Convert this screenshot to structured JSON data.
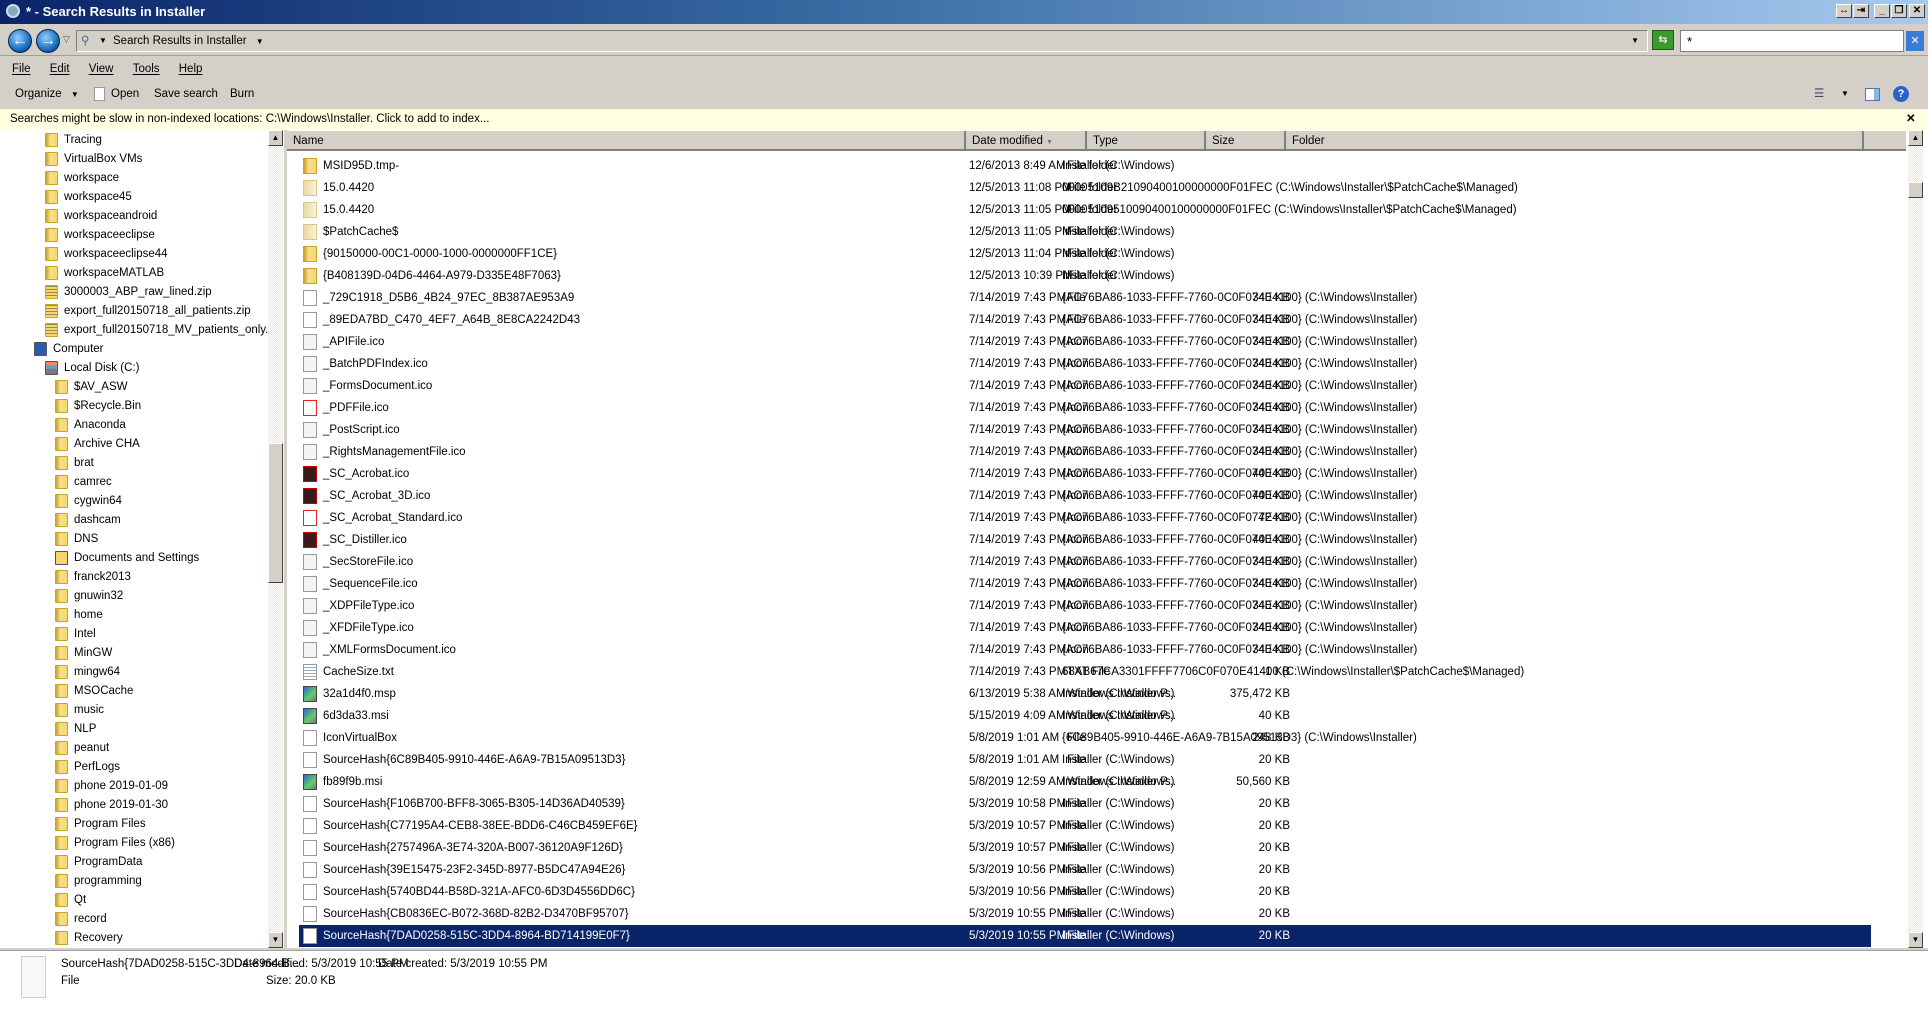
{
  "window": {
    "title": "* - Search Results in Installer"
  },
  "address": {
    "path": "Search Results in Installer",
    "search_value": "*"
  },
  "menu": [
    "File",
    "Edit",
    "View",
    "Tools",
    "Help"
  ],
  "toolbar": {
    "organize": "Organize",
    "open": "Open",
    "save_search": "Save search",
    "burn": "Burn"
  },
  "infobar": {
    "text": "Searches might be slow in non-indexed locations: C:\\Windows\\Installer. Click to add to index..."
  },
  "nav": [
    {
      "label": "Tracing",
      "level": 1,
      "icon": "folder"
    },
    {
      "label": "VirtualBox VMs",
      "level": 1,
      "icon": "folder"
    },
    {
      "label": "workspace",
      "level": 1,
      "icon": "folder"
    },
    {
      "label": "workspace45",
      "level": 1,
      "icon": "folder"
    },
    {
      "label": "workspaceandroid",
      "level": 1,
      "icon": "folder"
    },
    {
      "label": "workspaceeclipse",
      "level": 1,
      "icon": "folder"
    },
    {
      "label": "workspaceeclipse44",
      "level": 1,
      "icon": "folder"
    },
    {
      "label": "workspaceMATLAB",
      "level": 1,
      "icon": "folder"
    },
    {
      "label": "3000003_ABP_raw_lined.zip",
      "level": 1,
      "icon": "zip"
    },
    {
      "label": "export_full20150718_all_patients.zip",
      "level": 1,
      "icon": "zip"
    },
    {
      "label": "export_full20150718_MV_patients_only.zip",
      "level": 1,
      "icon": "zip"
    },
    {
      "label": "Computer",
      "level": 0,
      "icon": "computer"
    },
    {
      "label": "Local Disk (C:)",
      "level": 1,
      "icon": "drive"
    },
    {
      "label": "$AV_ASW",
      "level": 2,
      "icon": "folder"
    },
    {
      "label": "$Recycle.Bin",
      "level": 2,
      "icon": "folder"
    },
    {
      "label": "Anaconda",
      "level": 2,
      "icon": "folder"
    },
    {
      "label": "Archive CHA",
      "level": 2,
      "icon": "folder"
    },
    {
      "label": "brat",
      "level": 2,
      "icon": "folder"
    },
    {
      "label": "camrec",
      "level": 2,
      "icon": "folder"
    },
    {
      "label": "cygwin64",
      "level": 2,
      "icon": "folder"
    },
    {
      "label": "dashcam",
      "level": 2,
      "icon": "folder"
    },
    {
      "label": "DNS",
      "level": 2,
      "icon": "folder"
    },
    {
      "label": "Documents and Settings",
      "level": 2,
      "icon": "shortcut"
    },
    {
      "label": "franck2013",
      "level": 2,
      "icon": "folder"
    },
    {
      "label": "gnuwin32",
      "level": 2,
      "icon": "folder"
    },
    {
      "label": "home",
      "level": 2,
      "icon": "folder"
    },
    {
      "label": "Intel",
      "level": 2,
      "icon": "folder"
    },
    {
      "label": "MinGW",
      "level": 2,
      "icon": "folder"
    },
    {
      "label": "mingw64",
      "level": 2,
      "icon": "folder"
    },
    {
      "label": "MSOCache",
      "level": 2,
      "icon": "folder"
    },
    {
      "label": "music",
      "level": 2,
      "icon": "folder"
    },
    {
      "label": "NLP",
      "level": 2,
      "icon": "folder"
    },
    {
      "label": "peanut",
      "level": 2,
      "icon": "folder"
    },
    {
      "label": "PerfLogs",
      "level": 2,
      "icon": "folder"
    },
    {
      "label": "phone 2019-01-09",
      "level": 2,
      "icon": "folder"
    },
    {
      "label": "phone 2019-01-30",
      "level": 2,
      "icon": "folder"
    },
    {
      "label": "Program Files",
      "level": 2,
      "icon": "folder"
    },
    {
      "label": "Program Files (x86)",
      "level": 2,
      "icon": "folder"
    },
    {
      "label": "ProgramData",
      "level": 2,
      "icon": "folder"
    },
    {
      "label": "programming",
      "level": 2,
      "icon": "folder"
    },
    {
      "label": "Qt",
      "level": 2,
      "icon": "folder"
    },
    {
      "label": "record",
      "level": 2,
      "icon": "folder"
    },
    {
      "label": "Recovery",
      "level": 2,
      "icon": "folder"
    }
  ],
  "columns": {
    "name": "Name",
    "date": "Date modified",
    "type": "Type",
    "size": "Size",
    "folder": "Folder"
  },
  "files": [
    {
      "name": "MSID95D.tmp-",
      "date": "12/6/2013 8:49 AM",
      "type": "File folder",
      "size": "",
      "folder": "Installer (C:\\Windows)",
      "icon": "folder"
    },
    {
      "name": "15.0.4420",
      "date": "12/5/2013 11:08 PM",
      "type": "File folder",
      "size": "",
      "folder": "00005109B21090400100000000F01FEC (C:\\Windows\\Installer\\$PatchCache$\\Managed)",
      "icon": "folder-light"
    },
    {
      "name": "15.0.4420",
      "date": "12/5/2013 11:05 PM",
      "type": "File folder",
      "size": "",
      "folder": "00005109510090400100000000F01FEC (C:\\Windows\\Installer\\$PatchCache$\\Managed)",
      "icon": "folder-light"
    },
    {
      "name": "$PatchCache$",
      "date": "12/5/2013 11:05 PM",
      "type": "File folder",
      "size": "",
      "folder": "Installer (C:\\Windows)",
      "icon": "folder-light"
    },
    {
      "name": "{90150000-00C1-0000-1000-0000000FF1CE}",
      "date": "12/5/2013 11:04 PM",
      "type": "File folder",
      "size": "",
      "folder": "Installer (C:\\Windows)",
      "icon": "folder"
    },
    {
      "name": "{B408139D-04D6-4464-A979-D335E48F7063}",
      "date": "12/5/2013 10:39 PM",
      "type": "File folder",
      "size": "",
      "folder": "Installer (C:\\Windows)",
      "icon": "folder"
    },
    {
      "name": "_729C1918_D5B6_4B24_97EC_8B387AE953A9",
      "date": "7/14/2019 7:43 PM",
      "type": "File",
      "size": "340 KB",
      "folder": "{AC76BA86-1033-FFFF-7760-0C0F074E4100} (C:\\Windows\\Installer)",
      "icon": "file"
    },
    {
      "name": "_89EDA7BD_C470_4EF7_A64B_8E8CA2242D43",
      "date": "7/14/2019 7:43 PM",
      "type": "File",
      "size": "340 KB",
      "folder": "{AC76BA86-1033-FFFF-7760-0C0F074E4100} (C:\\Windows\\Installer)",
      "icon": "file"
    },
    {
      "name": "_APIFile.ico",
      "date": "7/14/2019 7:43 PM",
      "type": "Icon",
      "size": "340 KB",
      "folder": "{AC76BA86-1033-FFFF-7760-0C0F074E4100} (C:\\Windows\\Installer)",
      "icon": "ico"
    },
    {
      "name": "_BatchPDFIndex.ico",
      "date": "7/14/2019 7:43 PM",
      "type": "Icon",
      "size": "340 KB",
      "folder": "{AC76BA86-1033-FFFF-7760-0C0F074E4100} (C:\\Windows\\Installer)",
      "icon": "ico"
    },
    {
      "name": "_FormsDocument.ico",
      "date": "7/14/2019 7:43 PM",
      "type": "Icon",
      "size": "340 KB",
      "folder": "{AC76BA86-1033-FFFF-7760-0C0F074E4100} (C:\\Windows\\Installer)",
      "icon": "ico"
    },
    {
      "name": "_PDFFile.ico",
      "date": "7/14/2019 7:43 PM",
      "type": "Icon",
      "size": "340 KB",
      "folder": "{AC76BA86-1033-FFFF-7760-0C0F074E4100} (C:\\Windows\\Installer)",
      "icon": "pdf"
    },
    {
      "name": "_PostScript.ico",
      "date": "7/14/2019 7:43 PM",
      "type": "Icon",
      "size": "340 KB",
      "folder": "{AC76BA86-1033-FFFF-7760-0C0F074E4100} (C:\\Windows\\Installer)",
      "icon": "ico"
    },
    {
      "name": "_RightsManagementFile.ico",
      "date": "7/14/2019 7:43 PM",
      "type": "Icon",
      "size": "340 KB",
      "folder": "{AC76BA86-1033-FFFF-7760-0C0F074E4100} (C:\\Windows\\Installer)",
      "icon": "ico"
    },
    {
      "name": "_SC_Acrobat.ico",
      "date": "7/14/2019 7:43 PM",
      "type": "Icon",
      "size": "400 KB",
      "folder": "{AC76BA86-1033-FFFF-7760-0C0F074E4100} (C:\\Windows\\Installer)",
      "icon": "acrobat"
    },
    {
      "name": "_SC_Acrobat_3D.ico",
      "date": "7/14/2019 7:43 PM",
      "type": "Icon",
      "size": "400 KB",
      "folder": "{AC76BA86-1033-FFFF-7760-0C0F074E4100} (C:\\Windows\\Installer)",
      "icon": "acrobat"
    },
    {
      "name": "_SC_Acrobat_Standard.ico",
      "date": "7/14/2019 7:43 PM",
      "type": "Icon",
      "size": "72 KB",
      "folder": "{AC76BA86-1033-FFFF-7760-0C0F074E4100} (C:\\Windows\\Installer)",
      "icon": "pdf"
    },
    {
      "name": "_SC_Distiller.ico",
      "date": "7/14/2019 7:43 PM",
      "type": "Icon",
      "size": "400 KB",
      "folder": "{AC76BA86-1033-FFFF-7760-0C0F074E4100} (C:\\Windows\\Installer)",
      "icon": "acrobat"
    },
    {
      "name": "_SecStoreFile.ico",
      "date": "7/14/2019 7:43 PM",
      "type": "Icon",
      "size": "340 KB",
      "folder": "{AC76BA86-1033-FFFF-7760-0C0F074E4100} (C:\\Windows\\Installer)",
      "icon": "ico"
    },
    {
      "name": "_SequenceFile.ico",
      "date": "7/14/2019 7:43 PM",
      "type": "Icon",
      "size": "340 KB",
      "folder": "{AC76BA86-1033-FFFF-7760-0C0F074E4100} (C:\\Windows\\Installer)",
      "icon": "ico"
    },
    {
      "name": "_XDPFileType.ico",
      "date": "7/14/2019 7:43 PM",
      "type": "Icon",
      "size": "340 KB",
      "folder": "{AC76BA86-1033-FFFF-7760-0C0F074E4100} (C:\\Windows\\Installer)",
      "icon": "ico"
    },
    {
      "name": "_XFDFileType.ico",
      "date": "7/14/2019 7:43 PM",
      "type": "Icon",
      "size": "340 KB",
      "folder": "{AC76BA86-1033-FFFF-7760-0C0F074E4100} (C:\\Windows\\Installer)",
      "icon": "ico"
    },
    {
      "name": "_XMLFormsDocument.ico",
      "date": "7/14/2019 7:43 PM",
      "type": "Icon",
      "size": "340 KB",
      "folder": "{AC76BA86-1033-FFFF-7760-0C0F074E4100} (C:\\Windows\\Installer)",
      "icon": "ico"
    },
    {
      "name": "CacheSize.txt",
      "date": "7/14/2019 7:43 PM",
      "type": "TXT File",
      "size": "1 KB",
      "folder": "68AB67CA3301FFFF7706C0F070E41400 (C:\\Windows\\Installer\\$PatchCache$\\Managed)",
      "icon": "txt"
    },
    {
      "name": "32a1d4f0.msp",
      "date": "6/13/2019 5:38 AM",
      "type": "Windows Installer P...",
      "size": "375,472 KB",
      "folder": "Installer (C:\\Windows)",
      "icon": "msi"
    },
    {
      "name": "6d3da33.msi",
      "date": "5/15/2019 4:09 AM",
      "type": "Windows Installer P...",
      "size": "40 KB",
      "folder": "Installer (C:\\Windows)",
      "icon": "msi"
    },
    {
      "name": "IconVirtualBox",
      "date": "5/8/2019 1:01 AM",
      "type": "File",
      "size": "248 KB",
      "folder": "{6C89B405-9910-446E-A6A9-7B15A09513D3} (C:\\Windows\\Installer)",
      "icon": "file"
    },
    {
      "name": "SourceHash{6C89B405-9910-446E-A6A9-7B15A09513D3}",
      "date": "5/8/2019 1:01 AM",
      "type": "File",
      "size": "20 KB",
      "folder": "Installer (C:\\Windows)",
      "icon": "file"
    },
    {
      "name": "fb89f9b.msi",
      "date": "5/8/2019 12:59 AM",
      "type": "Windows Installer P...",
      "size": "50,560 KB",
      "folder": "Installer (C:\\Windows)",
      "icon": "msi"
    },
    {
      "name": "SourceHash{F106B700-BFF8-3065-B305-14D36AD40539}",
      "date": "5/3/2019 10:58 PM",
      "type": "File",
      "size": "20 KB",
      "folder": "Installer (C:\\Windows)",
      "icon": "file"
    },
    {
      "name": "SourceHash{C77195A4-CEB8-38EE-BDD6-C46CB459EF6E}",
      "date": "5/3/2019 10:57 PM",
      "type": "File",
      "size": "20 KB",
      "folder": "Installer (C:\\Windows)",
      "icon": "file"
    },
    {
      "name": "SourceHash{2757496A-3E74-320A-B007-36120A9F126D}",
      "date": "5/3/2019 10:57 PM",
      "type": "File",
      "size": "20 KB",
      "folder": "Installer (C:\\Windows)",
      "icon": "file"
    },
    {
      "name": "SourceHash{39E15475-23F2-345D-8977-B5DC47A94E26}",
      "date": "5/3/2019 10:56 PM",
      "type": "File",
      "size": "20 KB",
      "folder": "Installer (C:\\Windows)",
      "icon": "file"
    },
    {
      "name": "SourceHash{5740BD44-B58D-321A-AFC0-6D3D4556DD6C}",
      "date": "5/3/2019 10:56 PM",
      "type": "File",
      "size": "20 KB",
      "folder": "Installer (C:\\Windows)",
      "icon": "file"
    },
    {
      "name": "SourceHash{CB0836EC-B072-368D-82B2-D3470BF95707}",
      "date": "5/3/2019 10:55 PM",
      "type": "File",
      "size": "20 KB",
      "folder": "Installer (C:\\Windows)",
      "icon": "file"
    },
    {
      "name": "SourceHash{7DAD0258-515C-3DD4-8964-BD714199E0F7}",
      "date": "5/3/2019 10:55 PM",
      "type": "File",
      "size": "20 KB",
      "folder": "Installer (C:\\Windows)",
      "icon": "file",
      "selected": true
    }
  ],
  "details": {
    "name": "SourceHash{7DAD0258-515C-3DD4-8964-B...",
    "type": "File",
    "date_modified": "Date modified: 5/3/2019 10:55 PM",
    "date_created": "Date created: 5/3/2019 10:55 PM",
    "size": "Size: 20.0 KB"
  },
  "colors": {
    "selection": "#0a246a",
    "infobar": "#ffffe1",
    "chrome": "#d4d0c8"
  }
}
